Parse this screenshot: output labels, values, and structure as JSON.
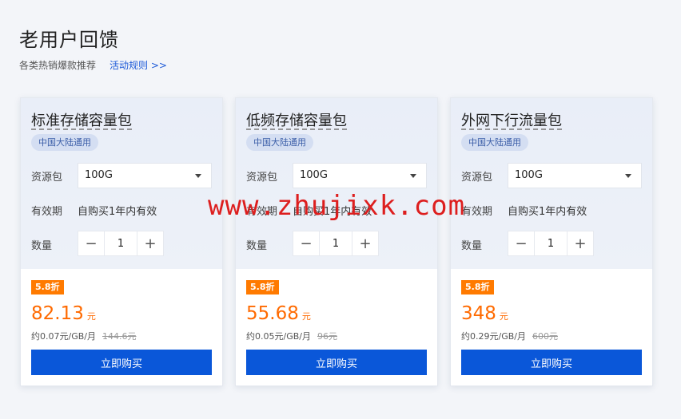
{
  "header": {
    "title": "老用户回馈",
    "subtitle": "各类热销爆款推荐",
    "rules_link": "活动规则 >>"
  },
  "labels": {
    "resource_pack": "资源包",
    "validity": "有效期",
    "quantity": "数量",
    "buy": "立即购买",
    "currency_unit": "元"
  },
  "cards": [
    {
      "title": "标准存储容量包",
      "region": "中国大陆通用",
      "pack": "100G",
      "validity": "自购买1年内有效",
      "quantity": "1",
      "discount": "5.8折",
      "price": "82.13",
      "per_unit": "约0.07元/GB/月",
      "original_price": "144.6元"
    },
    {
      "title": "低频存储容量包",
      "region": "中国大陆通用",
      "pack": "100G",
      "validity": "自购买1年内有效",
      "quantity": "1",
      "discount": "5.8折",
      "price": "55.68",
      "per_unit": "约0.05元/GB/月",
      "original_price": "96元"
    },
    {
      "title": "外网下行流量包",
      "region": "中国大陆通用",
      "pack": "100G",
      "validity": "自购买1年内有效",
      "quantity": "1",
      "discount": "5.8折",
      "price": "348",
      "per_unit": "约0.29元/GB/月",
      "original_price": "600元"
    }
  ],
  "watermark": "www.zhujixk.com",
  "icons": {
    "minus": "minus-icon",
    "plus": "plus-icon",
    "dropdown": "chevron-down-icon"
  },
  "colors": {
    "accent": "#0a57d9",
    "price": "#ff6a00",
    "discount_badge": "#ff7a00",
    "watermark": "#dd1e1e"
  }
}
